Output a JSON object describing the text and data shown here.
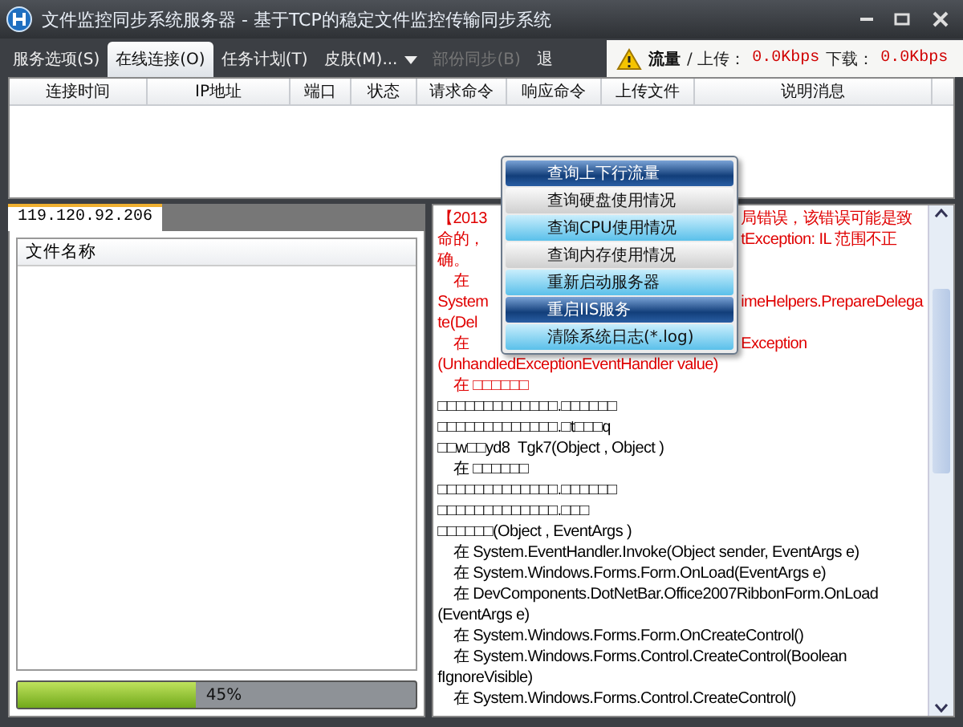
{
  "window": {
    "title": "文件监控同步系统服务器 - 基于TCP的稳定文件监控传输同步系统"
  },
  "tabs": [
    {
      "label": "服务选项(S)",
      "selected": false,
      "disabled": false
    },
    {
      "label": "在线连接(O)",
      "selected": true,
      "disabled": false
    },
    {
      "label": "任务计划(T)",
      "selected": false,
      "disabled": false
    },
    {
      "label": "皮肤(M)...",
      "selected": false,
      "disabled": false,
      "dropdown": true
    },
    {
      "label": "部份同步(B)",
      "selected": false,
      "disabled": true
    },
    {
      "label": "退",
      "selected": false,
      "disabled": false,
      "dropdown": false
    }
  ],
  "traffic": {
    "title": "流量",
    "upload_label": "/ 上传：",
    "upload": "0.0Kbps",
    "download_label": "下载：",
    "download": "0.0Kbps"
  },
  "connections": {
    "columns": [
      "连接时间",
      "IP地址",
      "端口",
      "状态",
      "请求命令",
      "响应命令",
      "上传文件",
      "说明消息"
    ]
  },
  "client_tab": {
    "label": "119.120.92.206",
    "selected": true
  },
  "files": {
    "columns": [
      "文件名称"
    ]
  },
  "progress": {
    "level": 0.45,
    "reading": "45%"
  },
  "log": [
    {
      "left": "【2013",
      "right": "局错误，该错误可能是致",
      "color": "#e00000"
    },
    {
      "left": "命的，",
      "right": "tException: IL 范围不正",
      "color": "#e00000"
    },
    {
      "left": "确。",
      "color": "#e00000"
    },
    {
      "left": "    在",
      "color": "#e00000"
    },
    {
      "left": "System",
      "right": "imeHelpers.PrepareDelega",
      "color": "#e00000"
    },
    {
      "left": "te(Del",
      "color": "#e00000"
    },
    {
      "left": "    在",
      "right": "Exception",
      "color": "#e00000"
    },
    {
      "left": "(UnhandledExceptionEventHandler value)",
      "color": "#e00000"
    },
    {
      "left": "    在 □□□□□□",
      "color": "#e00000"
    },
    {
      "left": "□□□□□□□□□□□□□.□□□□□□",
      "color": "#000000"
    },
    {
      "left": "□□□□□□□□□□□□□.□t□□□q",
      "color": "#000000"
    },
    {
      "left": "□□w□□yd8  Tgk7(Object , Object )",
      "color": "#000000"
    },
    {
      "left": "    在 □□□□□□",
      "color": "#000000"
    },
    {
      "left": "□□□□□□□□□□□□□.□□□□□□",
      "color": "#000000"
    },
    {
      "left": "□□□□□□□□□□□□□.□□□",
      "color": "#000000"
    },
    {
      "left": "□□□□□□(Object , EventArgs )",
      "color": "#000000"
    },
    {
      "left": "    在 System.EventHandler.Invoke(Object sender, EventArgs e)",
      "color": "#000000"
    },
    {
      "left": "    在 System.Windows.Forms.Form.OnLoad(EventArgs e)",
      "color": "#000000"
    },
    {
      "left": "    在 DevComponents.DotNetBar.Office2007RibbonForm.OnLoad",
      "color": "#000000"
    },
    {
      "left": "(EventArgs e)",
      "color": "#000000"
    },
    {
      "left": "    在 System.Windows.Forms.Form.OnCreateControl()",
      "color": "#000000"
    },
    {
      "left": "    在 System.Windows.Forms.Control.CreateControl(Boolean",
      "color": "#000000"
    },
    {
      "left": "fIgnoreVisible)",
      "color": "#000000"
    },
    {
      "left": "    在 System.Windows.Forms.Control.CreateControl()",
      "color": "#000000"
    }
  ],
  "context_menu": [
    {
      "label": "查询上下行流量",
      "kind": "dark"
    },
    {
      "label": "查询硬盘使用情况",
      "kind": "gray"
    },
    {
      "label": "查询CPU使用情况",
      "kind": "light"
    },
    {
      "label": "查询内存使用情况",
      "kind": "gray"
    },
    {
      "label": "重新启动服务器",
      "kind": "light"
    },
    {
      "label": "重启IIS服务",
      "kind": "dark"
    },
    {
      "label": "清除系统日志(*.log)",
      "kind": "light"
    }
  ]
}
